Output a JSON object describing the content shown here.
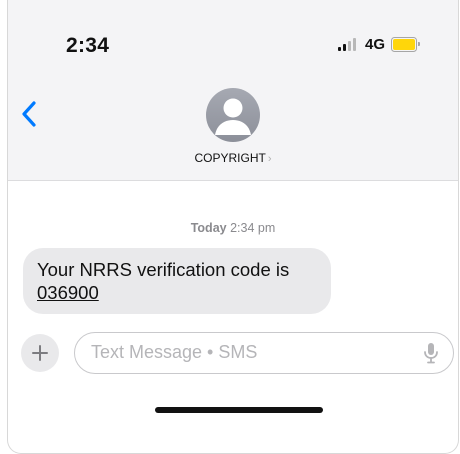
{
  "status_bar": {
    "time": "2:34",
    "network": "4G",
    "signal_bars_active": 2,
    "signal_bars_total": 4,
    "battery_color": "#ffd60a",
    "battery_level": 1.0
  },
  "header": {
    "back_icon": "chevron-left-icon",
    "contact_name": "COPYRIGHT",
    "contact_chevron": "›",
    "accent_color": "#007aff"
  },
  "conversation": {
    "timestamp_day": "Today",
    "timestamp_time": "2:34 pm",
    "messages": [
      {
        "direction": "incoming",
        "text": "Your NRRS verification code is",
        "code": "036900"
      }
    ]
  },
  "composer": {
    "plus_label": "+",
    "placeholder": "Text Message • SMS",
    "mic_icon": "microphone-icon"
  }
}
